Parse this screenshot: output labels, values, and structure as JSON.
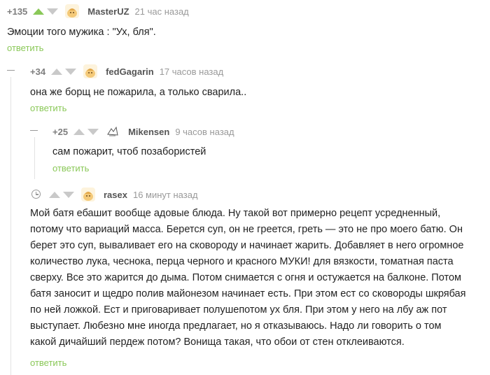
{
  "colors": {
    "accent_green": "#8ac858",
    "arrow_grey": "#c9c9c9",
    "meta_grey": "#999999"
  },
  "comments": [
    {
      "rating": "+135",
      "user": "MasterUZ",
      "time": "21 час назад",
      "text": "Эмоции того мужика : \"Ух, бля\".",
      "reply": "ответить",
      "avatar_icon": "default-avatar-icon"
    },
    {
      "rating": "+34",
      "user": "fedGagarin",
      "time": "17 часов назад",
      "text": "она же борщ не пожарила, а только сварила..",
      "reply": "ответить",
      "avatar_icon": "default-avatar-icon"
    },
    {
      "rating": "+25",
      "user": "Mikensen",
      "time": "9 часов назад",
      "text": "сам пожарит, чтоб позабористей",
      "reply": "ответить",
      "avatar_icon": "sketch-avatar-icon"
    },
    {
      "rating": "",
      "user": "rasex",
      "time": "16 минут назад",
      "text_lines": [
        "Мой батя ебашит вообще адовые блюда. Ну такой вот примерно рецепт усредненный,",
        "потому что вариаций масса. Берется суп, он не греется, греть — это не про моего батю. Он",
        "берет это суп, вываливает его на сковороду и начинает жарить. Добавляет в него огромное",
        "количество лука, чеснока, перца черного и красного МУКИ! для вязкости, томатная паста",
        "сверху. Все это жарится до дыма. Потом снимается с огня и остужается на балконе. Потом",
        "батя заносит и щедро полив майонезом начинает есть. При этом ест со сковороды шкрябая",
        "по ней ложкой. Ест и приговаривает полушепотом ух бля. При этом у него на лбу аж пот",
        "выступает. Любезно мне иногда предлагает, но я отказываюсь. Надо ли говорить о том",
        "какой дичайший пердеж потом? Вонища такая, что обои от стен отклеиваются."
      ],
      "reply": "ответить",
      "avatar_icon": "default-avatar-icon"
    }
  ]
}
